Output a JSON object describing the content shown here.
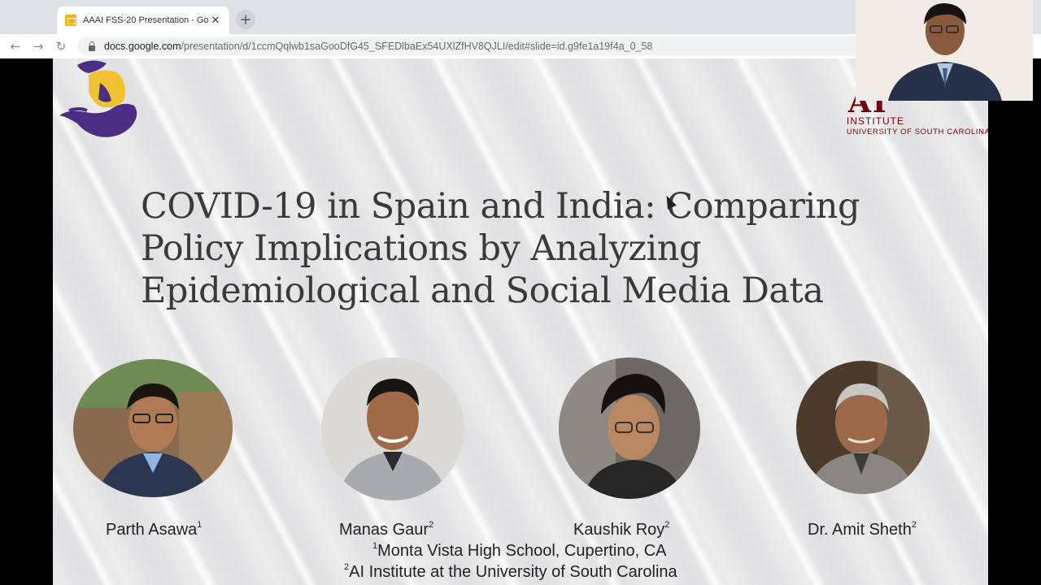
{
  "browser": {
    "tab_title": "AAAI FSS-20 Presentation - Go",
    "tab_close": "✕",
    "new_tab": "+",
    "url_host": "docs.google.com",
    "url_path": "/presentation/d/1ccmQqlwb1saGooDfG45_SFEDlbaEx54UXlZfHV8QJLI/edit#slide=id.g9fe1a19f4a_0_58",
    "back": "←",
    "forward": "→",
    "reload": "↻"
  },
  "slide": {
    "logo_right": {
      "mark": "AI",
      "institute": "INSTITUTE",
      "university": "UNIVERSITY OF SOUTH CAROLINA"
    },
    "title_lines": [
      "COVID-19 in Spain and India: Comparing",
      "Policy Implications by Analyzing",
      "Epidemiological and Social Media Data"
    ],
    "authors": [
      {
        "name": "Parth Asawa",
        "sup": "1"
      },
      {
        "name": "Manas Gaur",
        "sup": "2"
      },
      {
        "name": "Kaushik Roy",
        "sup": "2"
      },
      {
        "name": "Dr. Amit Sheth",
        "sup": "2"
      }
    ],
    "affiliations": [
      {
        "sup": "1",
        "text": "Monta Vista High School, Cupertino, CA"
      },
      {
        "sup": "2",
        "text": "AI Institute at the University of South Carolina"
      }
    ]
  },
  "colors": {
    "usc_garnet": "#73000a",
    "title_text": "#3a3a3a",
    "slides_yellow": "#f4b400"
  },
  "icons": [
    "slides-favicon",
    "lock-icon",
    "back-arrow-icon",
    "forward-arrow-icon",
    "reload-icon",
    "mouse-cursor-icon"
  ]
}
